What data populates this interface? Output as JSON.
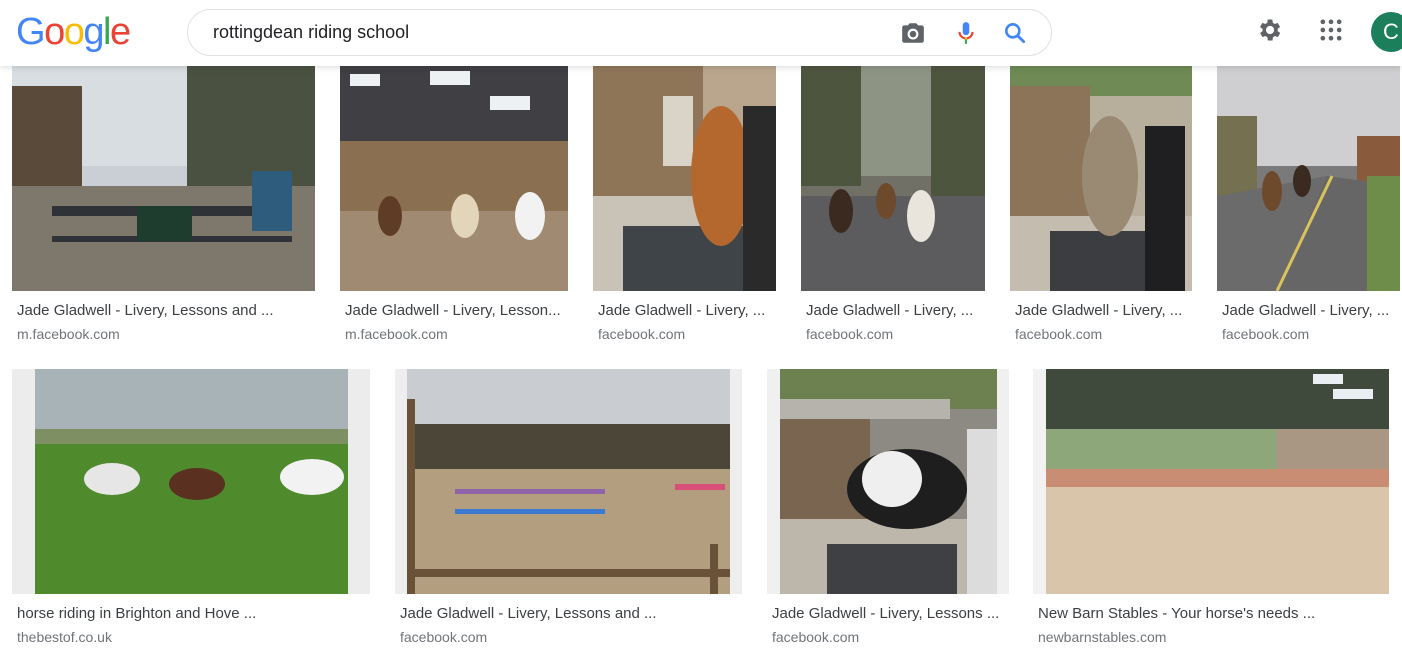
{
  "logo": {
    "letters": [
      "G",
      "o",
      "o",
      "g",
      "l",
      "e"
    ],
    "colors": [
      "#4285f4",
      "#ea4335",
      "#fbbc05",
      "#4285f4",
      "#34a853",
      "#ea4335"
    ]
  },
  "search": {
    "query": "rottingdean riding school"
  },
  "icons": {
    "camera": "camera-icon",
    "mic": "microphone-icon",
    "search": "search-icon",
    "settings": "gear-icon",
    "apps": "apps-grid-icon"
  },
  "account": {
    "initial": "C",
    "color": "#1a7f5a"
  },
  "results": [
    {
      "title": "Jade Gladwell - Livery, Lessons and ...",
      "domain": "m.facebook.com",
      "scene": "gate"
    },
    {
      "title": "Jade Gladwell - Livery, Lesson...",
      "domain": "m.facebook.com",
      "scene": "arena-indoor"
    },
    {
      "title": "Jade Gladwell - Livery, ...",
      "domain": "facebook.com",
      "scene": "pony-stable"
    },
    {
      "title": "Jade Gladwell - Livery, ...",
      "domain": "facebook.com",
      "scene": "ride-road"
    },
    {
      "title": "Jade Gladwell - Livery, ...",
      "domain": "facebook.com",
      "scene": "horse-girl"
    },
    {
      "title": "Jade Gladwell - Livery, ...",
      "domain": "facebook.com",
      "scene": "road-street"
    },
    {
      "title": "horse riding in Brighton and Hove ...",
      "domain": "thebestof.co.uk",
      "scene": "field"
    },
    {
      "title": "Jade Gladwell - Livery, Lessons and ...",
      "domain": "facebook.com",
      "scene": "jumps"
    },
    {
      "title": "Jade Gladwell - Livery, Lessons ...",
      "domain": "facebook.com",
      "scene": "piebald"
    },
    {
      "title": "New Barn Stables - Your horse's needs ...",
      "domain": "newbarnstables.com",
      "scene": "barn"
    }
  ]
}
